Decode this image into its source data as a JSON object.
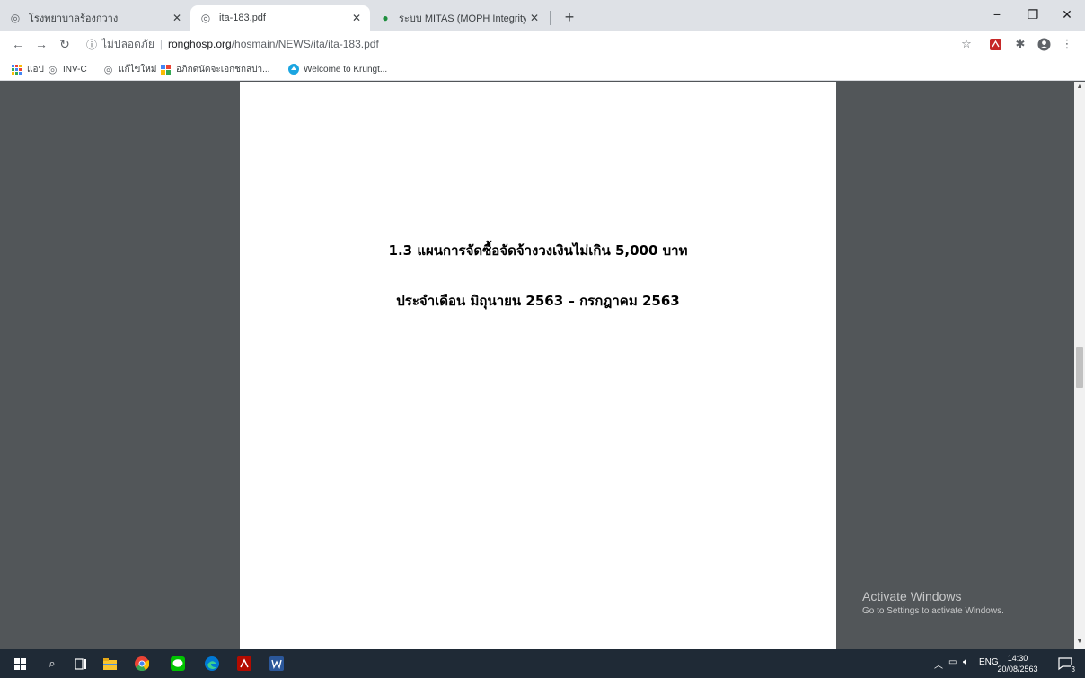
{
  "tabs": [
    {
      "title": "โรงพยาบาลร้องกวาง",
      "favicon": "globe-icon"
    },
    {
      "title": "ita-183.pdf",
      "favicon": "globe-icon",
      "active": true
    },
    {
      "title": "ระบบ MITAS (MOPH Integrity and",
      "favicon": "shield-icon"
    }
  ],
  "window_controls": {
    "minimize": "−",
    "restore": "❐",
    "close": "✕"
  },
  "address": {
    "security_label": "ไม่ปลอดภัย",
    "host": "ronghosp.org",
    "path": "/hosmain/NEWS/ita/ita-183.pdf"
  },
  "bookmarks": [
    {
      "label": "แอป",
      "icon": "apps-grid-icon"
    },
    {
      "label": "INV-C",
      "icon": "globe-icon"
    },
    {
      "label": "แก้ไขใหม่",
      "icon": "globe-icon"
    },
    {
      "label": "อภิกดนัดจะเอกชกลปา...",
      "icon": "grid-logo-icon"
    },
    {
      "label": "Welcome to Krungt...",
      "icon": "krungthai-logo-icon"
    }
  ],
  "pdf": {
    "line1": "1.3 แผนการจัดซื้อจัดจ้างวงเงินไม่เกิน 5,000 บาท",
    "line2": "ประจำเดือน มิถุนายน 2563 – กรกฎาคม 2563"
  },
  "watermark": {
    "title": "Activate Windows",
    "subtitle": "Go to Settings to activate Windows."
  },
  "taskbar": {
    "lang": "ENG",
    "time": "14:30",
    "date": "20/08/2563",
    "notification_count": "3"
  }
}
